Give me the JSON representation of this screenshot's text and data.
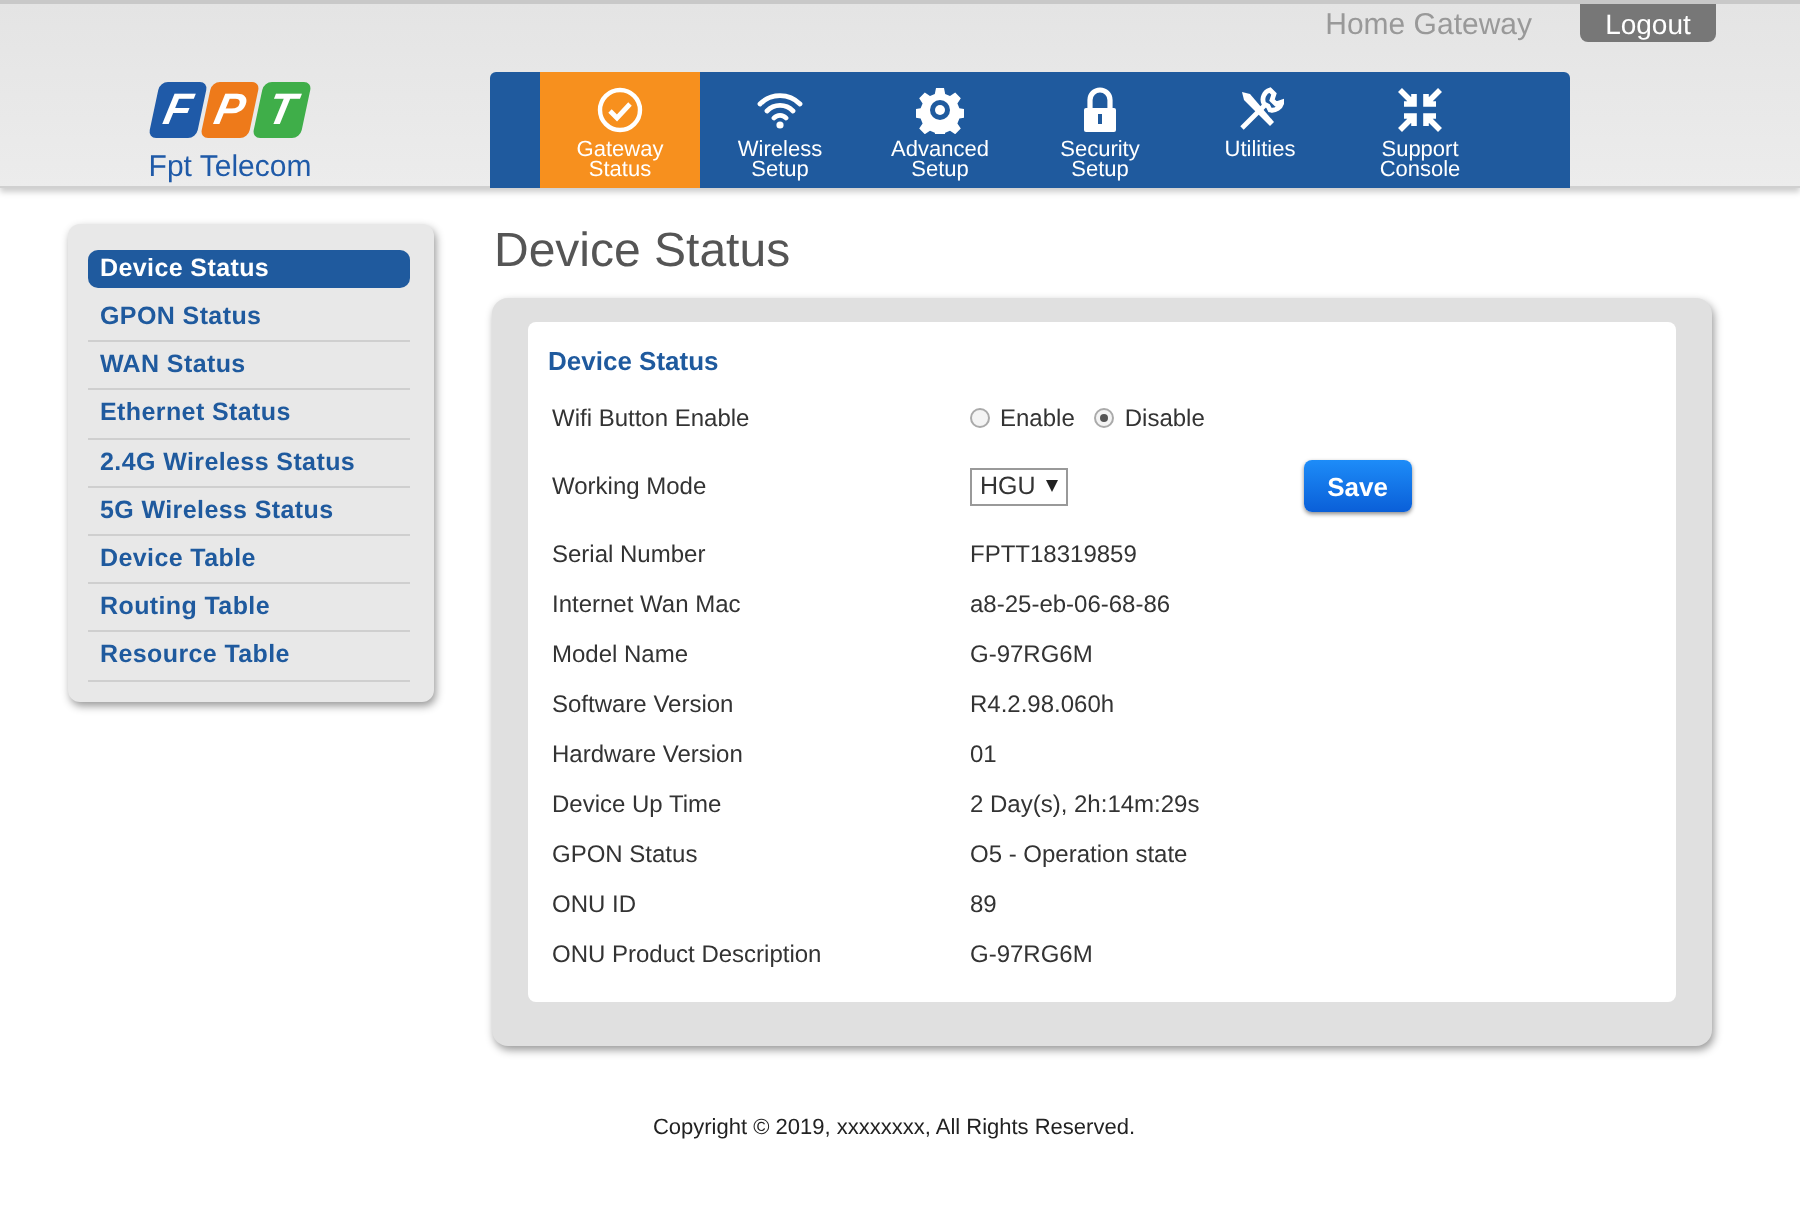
{
  "header": {
    "title": "Home Gateway",
    "logout": "Logout",
    "logo": {
      "letters": [
        "F",
        "P",
        "T"
      ],
      "caption": "Fpt Telecom"
    }
  },
  "nav": [
    {
      "label": "Gateway Status",
      "selected": true
    },
    {
      "label": "Wireless Setup",
      "selected": false
    },
    {
      "label": "Advanced Setup",
      "selected": false
    },
    {
      "label": "Security Setup",
      "selected": false
    },
    {
      "label": "Utilities",
      "selected": false
    },
    {
      "label": "Support Console",
      "selected": false
    }
  ],
  "sidebar": {
    "items": [
      {
        "label": "Device Status",
        "selected": true
      },
      {
        "label": "GPON Status",
        "selected": false
      },
      {
        "label": "WAN Status",
        "selected": false
      },
      {
        "label": "Ethernet Status",
        "selected": false
      },
      {
        "label": "2.4G Wireless Status",
        "selected": false
      },
      {
        "label": "5G Wireless Status",
        "selected": false
      },
      {
        "label": "Device Table",
        "selected": false
      },
      {
        "label": "Routing Table",
        "selected": false
      },
      {
        "label": "Resource Table",
        "selected": false
      }
    ]
  },
  "page_title": "Device Status",
  "panel": {
    "heading": "Device Status",
    "rows": [
      {
        "kind": "radio",
        "label": "Wifi Button Enable",
        "options": [
          {
            "label": "Enable",
            "selected": false
          },
          {
            "label": "Disable",
            "selected": true
          }
        ]
      },
      {
        "kind": "select",
        "label": "Working Mode",
        "value": "HGU",
        "button": "Save"
      },
      {
        "kind": "text",
        "label": "Serial Number",
        "value": "FPTT18319859"
      },
      {
        "kind": "text",
        "label": "Internet Wan Mac",
        "value": "a8-25-eb-06-68-86"
      },
      {
        "kind": "text",
        "label": "Model Name",
        "value": "G-97RG6M"
      },
      {
        "kind": "text",
        "label": "Software Version",
        "value": "R4.2.98.060h"
      },
      {
        "kind": "text",
        "label": "Hardware Version",
        "value": "01"
      },
      {
        "kind": "text",
        "label": "Device Up Time",
        "value": "2 Day(s), 2h:14m:29s"
      },
      {
        "kind": "text",
        "label": "GPON Status",
        "value": "O5 - Operation state"
      },
      {
        "kind": "text",
        "label": "ONU ID",
        "value": "89"
      },
      {
        "kind": "text",
        "label": "ONU Product Description",
        "value": "G-97RG6M"
      }
    ]
  },
  "footer": "Copyright © 2019, xxxxxxxx, All Rights Reserved."
}
